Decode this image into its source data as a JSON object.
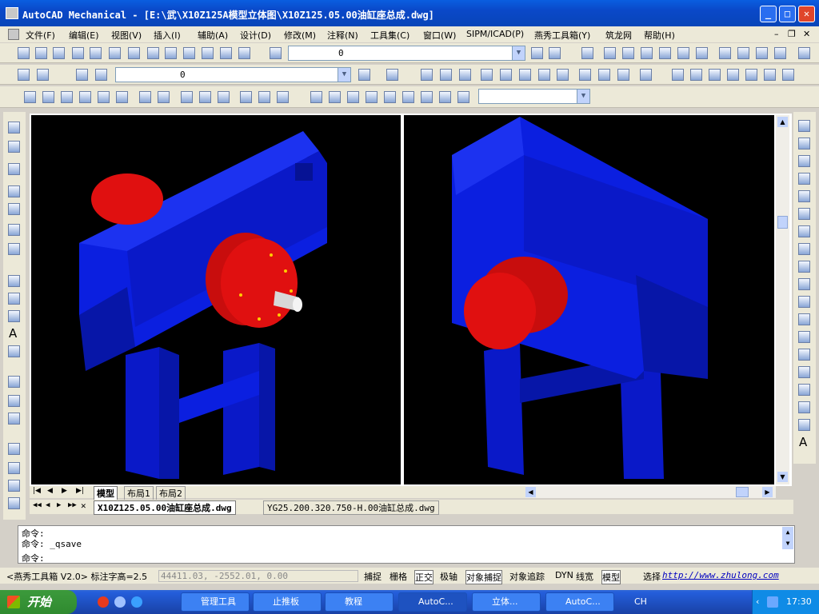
{
  "window": {
    "title": "AutoCAD Mechanical - [E:\\武\\X10Z125A模型立体图\\X10Z125.05.00油缸座总成.dwg]"
  },
  "menu": [
    "文件(F)",
    "编辑(E)",
    "视图(V)",
    "插入(I)",
    "辅助(A)",
    "设计(D)",
    "修改(M)",
    "注释(N)",
    "工具集(C)",
    "窗口(W)",
    "SIPM/ICAD(P)",
    "燕秀工具箱(Y)",
    "筑龙网",
    "帮助(H)"
  ],
  "layer_combo_top": "0",
  "layer_combo_second": "0",
  "tabs": {
    "model": "模型",
    "layout1": "布局1",
    "layout2": "布局2"
  },
  "doc_tabs": [
    "X10Z125.05.00油缸座总成.dwg",
    "YG25.200.320.750-H.00油缸总成.dwg"
  ],
  "command": {
    "line1": "命令:",
    "line2": "命令: _qsave",
    "prompt": "命令:"
  },
  "status": {
    "plugin": "<燕秀工具箱 V2.0> 标注字高=2.5",
    "coords": "44411.03, -2552.01, 0.00",
    "toggles": [
      "捕捉",
      "栅格",
      "正交",
      "极轴",
      "对象捕捉",
      "对象追踪",
      "DYN",
      "线宽",
      "模型"
    ],
    "select": "选择",
    "link": "http://www.zhulong.com"
  },
  "taskbar": {
    "start": "开始",
    "tasks": [
      "管理工具",
      "止推板",
      "教程",
      "AutoC...",
      "立体...",
      "AutoC..."
    ],
    "lang": "CH",
    "clock": "17:30"
  },
  "colors": {
    "model_blue": "#0b1fe0",
    "cylinder_red": "#e01010",
    "canvas": "#000000"
  }
}
